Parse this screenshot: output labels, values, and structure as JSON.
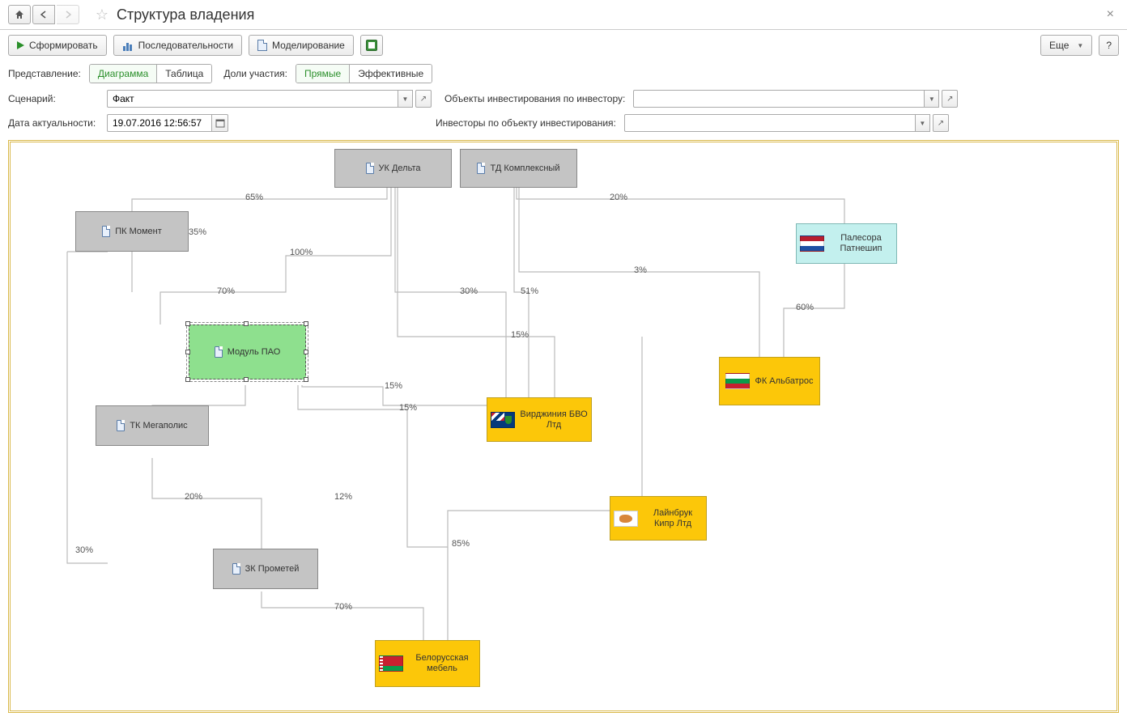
{
  "title": "Структура владения",
  "toolbar": {
    "form": "Сформировать",
    "sequences": "Последовательности",
    "modeling": "Моделирование",
    "more": "Еще",
    "help": "?"
  },
  "filters": {
    "view_label": "Представление:",
    "view_diagram": "Диаграмма",
    "view_table": "Таблица",
    "shares_label": "Доли участия:",
    "shares_direct": "Прямые",
    "shares_effective": "Эффективные",
    "scenario_label": "Сценарий:",
    "scenario_value": "Факт",
    "objects_by_investor_label": "Объекты инвестирования по инвестору:",
    "objects_by_investor_value": "",
    "date_label": "Дата актуальности:",
    "date_value": "19.07.2016 12:56:57",
    "investors_by_object_label": "Инвесторы по объекту инвестирования:",
    "investors_by_object_value": ""
  },
  "nodes": {
    "uk_delta": "УК Дельта",
    "td_kompleksny": "ТД Комплексный",
    "pk_moment": "ПК Момент",
    "palesora": "Палесора Патнешип",
    "modul_pao": "Модуль ПАО",
    "fk_albatros": "ФК Альбатрос",
    "tk_megapolis": "ТК Мегаполис",
    "virginia_bvo": "Вирджиния БВО Лтд",
    "zk_prometey": "ЗК Прометей",
    "lainbruk": "Лайнбрук Кипр Лтд",
    "bel_mebel": "Белорусская мебель"
  },
  "edges": {
    "e65": "65%",
    "e35": "35%",
    "e20": "20%",
    "e100": "100%",
    "e70": "70%",
    "e30": "30%",
    "e51": "51%",
    "e3": "3%",
    "e60": "60%",
    "e15a": "15%",
    "e15b": "15%",
    "e15c": "15%",
    "e20b": "20%",
    "e12": "12%",
    "e85": "85%",
    "e30b": "30%",
    "e70b": "70%"
  }
}
